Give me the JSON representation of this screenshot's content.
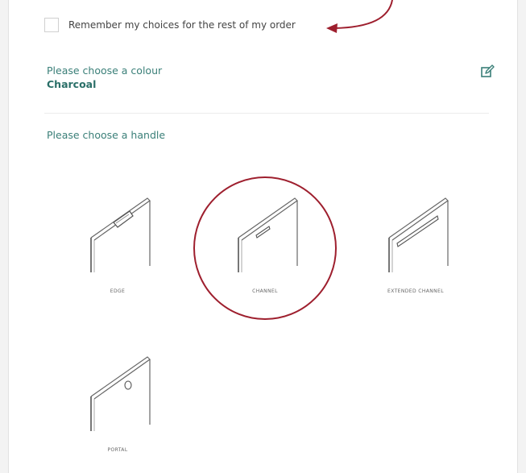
{
  "remember": {
    "label": "Remember my choices for the rest of my order",
    "checked": false
  },
  "colour": {
    "prompt": "Please choose a colour",
    "selected": "Charcoal"
  },
  "handle": {
    "prompt": "Please choose a handle",
    "options": [
      {
        "label": "EDGE"
      },
      {
        "label": "CHANNEL",
        "selected": true
      },
      {
        "label": "EXTENDED CHANNEL"
      },
      {
        "label": "PORTAL"
      }
    ]
  },
  "colors": {
    "accent_teal": "#3a7f78",
    "annotation_red": "#9e1f2e"
  },
  "icons": {
    "edit": "edit-icon"
  }
}
